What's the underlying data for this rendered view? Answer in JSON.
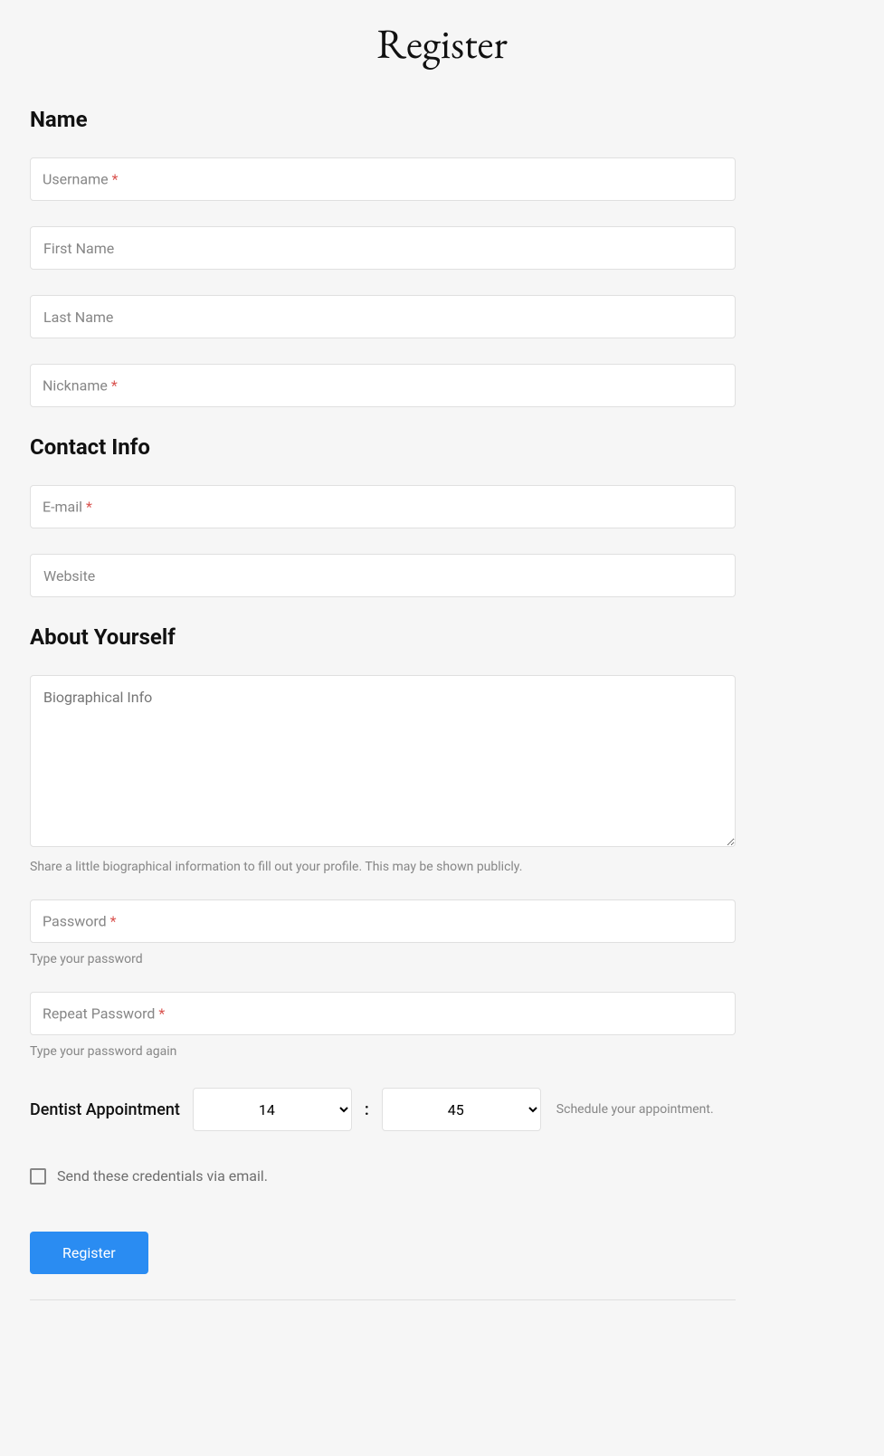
{
  "title": "Register",
  "sections": {
    "name": {
      "heading": "Name"
    },
    "contact": {
      "heading": "Contact Info"
    },
    "about": {
      "heading": "About Yourself"
    }
  },
  "fields": {
    "username": {
      "label": "Username",
      "required": true,
      "value": ""
    },
    "first_name": {
      "label": "First Name",
      "required": false,
      "value": ""
    },
    "last_name": {
      "label": "Last Name",
      "required": false,
      "value": ""
    },
    "nickname": {
      "label": "Nickname",
      "required": true,
      "value": ""
    },
    "email": {
      "label": "E-mail",
      "required": true,
      "value": ""
    },
    "website": {
      "label": "Website",
      "required": false,
      "value": ""
    },
    "bio": {
      "label": "Biographical Info",
      "required": false,
      "value": "",
      "help": "Share a little biographical information to fill out your profile. This may be shown publicly."
    },
    "password": {
      "label": "Password",
      "required": true,
      "value": "",
      "help": "Type your password"
    },
    "repeat_password": {
      "label": "Repeat Password",
      "required": true,
      "value": "",
      "help": "Type your password again"
    }
  },
  "appointment": {
    "label": "Dentist Appointment",
    "hour": "14",
    "minute": "45",
    "help": "Schedule your appointment."
  },
  "send_email": {
    "label": "Send these credentials via email.",
    "checked": false
  },
  "submit_label": "Register",
  "required_marker": "*"
}
